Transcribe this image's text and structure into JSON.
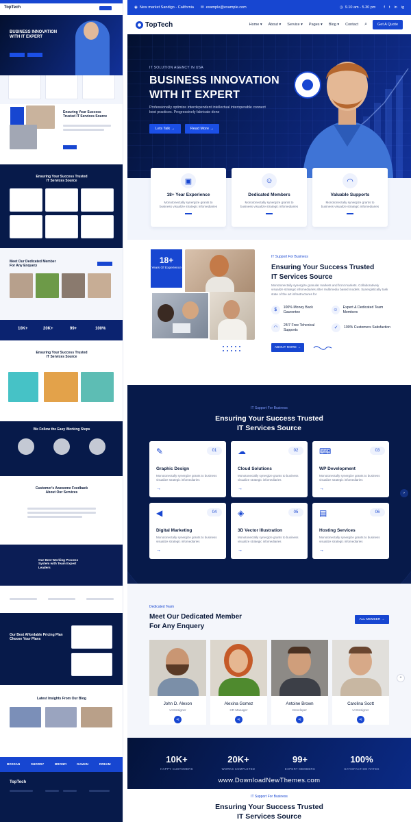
{
  "brand": {
    "name": "TopTech"
  },
  "topbar": {
    "address": "New market Sandigo - California",
    "email": "example@example.com",
    "hours": "9.10 am - 5.30 pm",
    "social": [
      "f",
      "t",
      "in",
      "ig"
    ]
  },
  "nav": {
    "items": [
      "Home",
      "About",
      "Service",
      "Pages",
      "Blog",
      "Contact"
    ],
    "quote": "Get A Quote"
  },
  "hero": {
    "kicker": "IT SOLUTION AGENCY IN USA",
    "title_line1": "BUSINESS INNOVATION",
    "title_line2": "WITH IT EXPERT",
    "desc": "Professionally optimize interdependent intellectual interoperable connect best practices. Progressively fabricate done",
    "btn1": "Lets Talk",
    "btn2": "Read More"
  },
  "features": [
    {
      "icon": "briefcase-icon",
      "title": "18+ Year Experience",
      "desc": "Monotonectally synergize grants to business visualize strategic infomediaries"
    },
    {
      "icon": "team-icon",
      "title": "Dedicated Members",
      "desc": "Monotonectally synergize grants to business visualize strategic infomediaries"
    },
    {
      "icon": "headset-icon",
      "title": "Valuable Supports",
      "desc": "Monotonectally synergize grants to business visualize strategic infomediaries"
    }
  ],
  "about": {
    "badge_num": "18+",
    "badge_label": "Years Of Experience",
    "kicker": "IT Support For Business",
    "title_line1": "Ensuring Your Success Trusted",
    "title_line2": "IT Services Source",
    "desc": "Monotonectally synergize granular markets and front markets. Collaboratively visualize strategic infomediaries after multimedia based models. Synergistically task state of the art infrastructures for",
    "feats": [
      "100% Money Back Gaurentee",
      "Expert & Dedicated Team Members",
      "24/7 Free Tehcnical Supports",
      "100% Customers Satisfaction"
    ],
    "btn": "ABOUT MORE"
  },
  "services": {
    "kicker": "IT Support For Business",
    "title_line1": "Ensuring Your Success Trusted",
    "title_line2": "IT Services Source",
    "items": [
      {
        "num": "01",
        "title": "Graphic Design",
        "desc": "Monotonectally synergize grants to business visualize strategic infomediaries"
      },
      {
        "num": "02",
        "title": "Cloud Solutions",
        "desc": "Monotonectally synergize grants to business visualize strategic infomediaries"
      },
      {
        "num": "03",
        "title": "WP Development",
        "desc": "Monotonectally synergize grants to business visualize strategic infomediaries"
      },
      {
        "num": "04",
        "title": "Digital Marketing",
        "desc": "Monotonectally synergize grants to business visualize strategic infomediaries"
      },
      {
        "num": "05",
        "title": "3D Vector Illustration",
        "desc": "Monotonectally synergize grants to business visualize strategic infomediaries"
      },
      {
        "num": "06",
        "title": "Hosting Services",
        "desc": "Monotonectally synergize grants to business visualize strategic infomediaries"
      }
    ]
  },
  "team": {
    "kicker": "Dedicated Team",
    "title_line1": "Meet Our Dedicated Member",
    "title_line2": "For Any Enquery",
    "btn": "ALL MEMBER",
    "members": [
      {
        "name": "John D. Alexon",
        "role": "UI Designer"
      },
      {
        "name": "Alexina Gomez",
        "role": "HR Manager"
      },
      {
        "name": "Antoine Brown",
        "role": "Developer"
      },
      {
        "name": "Carolina Scott",
        "role": "UI Designer"
      }
    ]
  },
  "stats": [
    {
      "value": "10K+",
      "label": "HAPPY CUSTOMERS"
    },
    {
      "value": "20K+",
      "label": "WORKS COMPLETED"
    },
    {
      "value": "99+",
      "label": "EXPERT MEMBERS"
    },
    {
      "value": "100%",
      "label": "SATISFACTION RATES"
    }
  ],
  "watermark": "www.DownloadNewThemes.com",
  "bottom": {
    "kicker": "IT Support For Business",
    "title_line1": "Ensuring Your Success Trusted",
    "title_line2": "IT Services Source"
  },
  "mini": {
    "hero_title": "BUSINESS INNOVATION WITH IT EXPERT",
    "services_title": "Ensuring Your Success Trusted IT Services Source",
    "team_title": "Meet Our Dedicated Member For Any Enquery",
    "stats": [
      "10K+",
      "20K+",
      "99+",
      "100%"
    ],
    "steps_title": "We Follow the Easy Working Steps",
    "feedback_title": "Customer's Awesome Feedback About Our Services",
    "process_title": "Our Best Working Process System with Team Expert Leaders",
    "pricing_title": "Our Best Affordable Pricing Plan Choose Your Plans",
    "blog_title": "Latest Insights From Our Blog",
    "brands": [
      "BOSSAN",
      "SHORDY",
      "BRONFI",
      "GAMAN",
      "DREAM"
    ]
  },
  "colors": {
    "primary": "#1746d1",
    "dark": "#071a4a",
    "text": "#0b1a3a"
  }
}
